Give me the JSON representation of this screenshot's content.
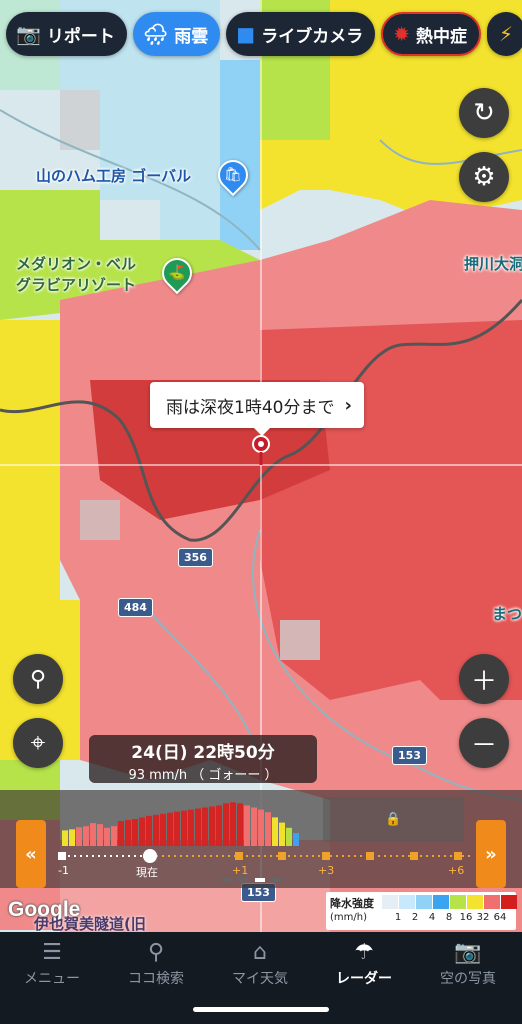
{
  "chips": [
    {
      "label": "リポート",
      "icon": "camera-icon",
      "state": "normal"
    },
    {
      "label": "雨雲",
      "icon": "rain-cloud-icon",
      "state": "active"
    },
    {
      "label": "ライブカメラ",
      "icon": "video-camera-icon",
      "state": "normal"
    },
    {
      "label": "熱中症",
      "icon": "sun-icon",
      "state": "warn"
    }
  ],
  "map": {
    "poi": [
      {
        "label": "山のハム工房 ゴーバル",
        "color": "blue"
      },
      {
        "label": "メダリオン・ベル\nグラビアリゾート",
        "color": "green"
      },
      {
        "label": "押川大洞",
        "color": "teal"
      },
      {
        "label": "まつ",
        "color": "teal"
      }
    ],
    "roads": [
      "356",
      "484",
      "153",
      "153"
    ],
    "bottom_label": "伊也賀美隧道(旧"
  },
  "callout": {
    "text": "雨は深夜1時40分まで"
  },
  "time": {
    "datetime": "24(日) 22時50分",
    "intensity": "93 mm/h （ ゴォーー ）"
  },
  "timeline": {
    "labels": [
      "-1",
      "現在",
      "+1",
      "+3",
      "+6"
    ],
    "bars": [
      0.3,
      0.32,
      0.36,
      0.38,
      0.44,
      0.42,
      0.35,
      0.38,
      0.48,
      0.5,
      0.52,
      0.55,
      0.58,
      0.6,
      0.62,
      0.64,
      0.66,
      0.68,
      0.7,
      0.72,
      0.74,
      0.76,
      0.78,
      0.82,
      0.84,
      0.82,
      0.78,
      0.74,
      0.7,
      0.65,
      0.55,
      0.45,
      0.35,
      0.25
    ],
    "colors": {
      "rain_heavy": "#d42525",
      "rain_strong": "#f07070",
      "rain_mid": "#f1e02c",
      "rain_light": "#b4e042",
      "rain_blue": "#3fa0f0"
    }
  },
  "legend": {
    "title": "降水強度",
    "unit": "(mm/h)",
    "levels": [
      "1",
      "2",
      "4",
      "8",
      "16",
      "32",
      "64"
    ],
    "colors": [
      "#e6eef5",
      "#c8e8fb",
      "#8fd2f5",
      "#3aa4f0",
      "#b6e34a",
      "#f4e32e",
      "#f07070",
      "#d41e1e"
    ]
  },
  "google": "Google",
  "nav": [
    {
      "label": "メニュー",
      "icon": "menu-icon",
      "active": false
    },
    {
      "label": "ココ検索",
      "icon": "search-icon",
      "active": false
    },
    {
      "label": "マイ天気",
      "icon": "home-icon",
      "active": false
    },
    {
      "label": "レーダー",
      "icon": "umbrella-icon",
      "active": true
    },
    {
      "label": "空の写真",
      "icon": "camera-icon",
      "active": false
    }
  ]
}
